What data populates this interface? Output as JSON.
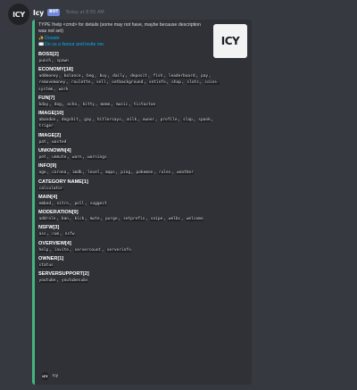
{
  "message": {
    "username": "Icy",
    "bot_tag": "BOT",
    "timestamp": "Today at 8:55 AM",
    "avatar_text": "ICY"
  },
  "embed": {
    "accent_color": "#43b581",
    "thumbnail_text": "ICY",
    "description": "TYPE !help <cmd> for details (some may not have, maybe because description was not set)",
    "donate_icon": "sparkle-icon",
    "donate_label": "Donate",
    "invite_icon": "envelope-icon",
    "invite_label": "Do us a favour and invite me.",
    "footer": "Icy",
    "fields": [
      {
        "name": "BOSS[2]",
        "commands": [
          "punch",
          "spawn"
        ]
      },
      {
        "name": "ECONOMY[18]",
        "commands": [
          "addmoney",
          "balance",
          "beg",
          "buy",
          "daily",
          "deposit",
          "fish",
          "leaderboard",
          "pay",
          "removemoney",
          "roulette",
          "sell",
          "setbackground",
          "setinfo",
          "shop",
          "slots",
          "coins-system",
          "work"
        ]
      },
      {
        "name": "FUN[7]",
        "commands": [
          "bday",
          "dog",
          "echo",
          "kitty",
          "meme",
          "music",
          "tictactoe"
        ]
      },
      {
        "name": "IMAGE[10]",
        "commands": [
          "abandon",
          "dogshit",
          "gay",
          "hitlersays",
          "milk",
          "owner",
          "profile",
          "slap",
          "spank",
          "triger"
        ]
      },
      {
        "name": "IMAGE[2]",
        "commands": [
          "pat",
          "wasted"
        ]
      },
      {
        "name": "UNKNOWN[4]",
        "commands": [
          "pet",
          "unmute",
          "warn",
          "warnings"
        ]
      },
      {
        "name": "INFO[9]",
        "commands": [
          "age",
          "corona",
          "imdb",
          "level",
          "maps",
          "ping",
          "pokemon",
          "rules",
          "weather"
        ]
      },
      {
        "name": "CATEGORY NAME[1]",
        "commands": [
          "calculator"
        ]
      },
      {
        "name": "MAIN[4]",
        "commands": [
          "embed",
          "nitro",
          "poll",
          "suggest"
        ]
      },
      {
        "name": "MODERATION[9]",
        "commands": [
          "addrole",
          "ban",
          "kick",
          "mute",
          "purge",
          "setprefix",
          "snipe",
          "welbc",
          "welcome"
        ]
      },
      {
        "name": "NSFW[3]",
        "commands": [
          "ass",
          "cum",
          "nsfw"
        ]
      },
      {
        "name": "OVERVIEW[4]",
        "commands": [
          "help",
          "invite",
          "servercount",
          "serverinfo"
        ]
      },
      {
        "name": "OWNER[1]",
        "commands": [
          "status"
        ]
      },
      {
        "name": "SERVERSUPPORT[2]",
        "commands": [
          "youtube",
          "youtubesubs"
        ]
      }
    ]
  }
}
